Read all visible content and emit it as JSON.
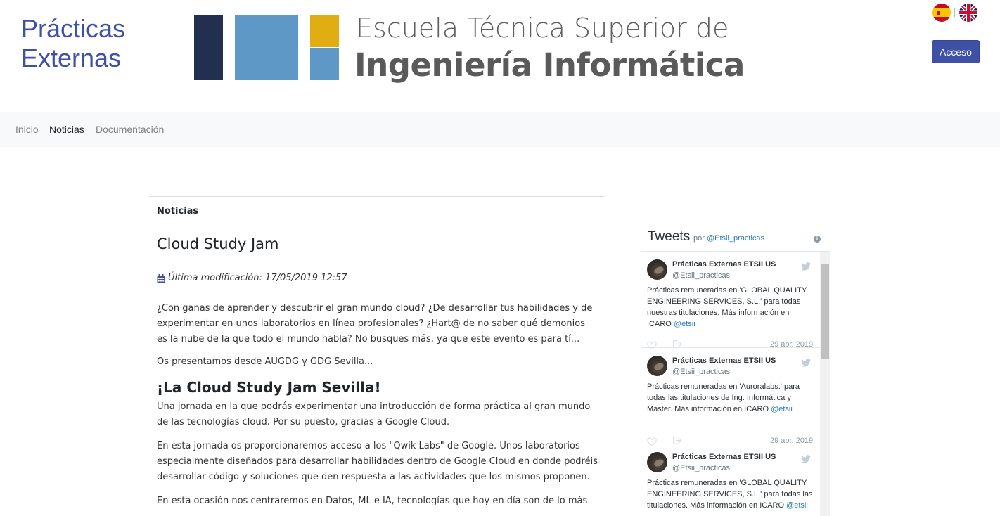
{
  "header": {
    "site_title_line1": "Prácticas",
    "site_title_line2": "Externas",
    "logo_line1": "Escuela Técnica Superior de",
    "logo_line2": "Ingeniería Informática",
    "lang_separator": "|",
    "login_button": "Acceso",
    "colors": {
      "brand": "#3f51a6",
      "logo_dark": "#232f4f",
      "logo_blue": "#5e98c6",
      "logo_yellow": "#e0ae12"
    }
  },
  "nav": {
    "items": [
      {
        "label": "Inicio",
        "active": false
      },
      {
        "label": "Noticias",
        "active": true
      },
      {
        "label": "Documentación",
        "active": false
      }
    ]
  },
  "main": {
    "section_title": "Noticias",
    "article": {
      "title": "Cloud Study Jam",
      "modified": "Última modificación: 17/05/2019 12:57",
      "paragraph1": "¿Con ganas de aprender y descubrir el gran mundo cloud? ¿De desarrollar tus habilidades y de experimentar en unos laboratorios en línea profesionales? ¿Hart@ de no saber qué demonios es la nube de la que todo el mundo habla? No busques más, ya que este evento es para tí...",
      "paragraph2": "Os presentamos desde AUGDG y GDG Sevilla...",
      "heading": "¡La Cloud Study Jam Sevilla!",
      "paragraph3": "Una jornada en la que podrás experimentar una introducción de forma práctica al gran mundo de las tecnologías cloud. Por su puesto, gracias a Google Cloud.",
      "paragraph4": "En esta jornada os proporcionaremos acceso a los \"Qwik Labs\" de Google. Unos laboratorios especialmente diseñados para desarrollar habilidades dentro de Google Cloud en donde podréis desarrollar código y soluciones que den respuesta a las actividades que los mismos proponen.",
      "paragraph5": "En esta ocasión nos centraremos en Datos, ML e IA, tecnologías que hoy en día son de lo más"
    }
  },
  "tweets": {
    "title": "Tweets",
    "by_prefix": "por",
    "by_handle": "@Etsii_practicas",
    "info_glyph": "i",
    "items": [
      {
        "name": "Prácticas Externas ETSII US",
        "handle": "@Etsii_practicas",
        "text": "Prácticas remuneradas en 'GLOBAL QUALITY ENGINEERING SERVICES, S.L.' para todas nuestras titulaciones. Más información en ICARO",
        "mention": "@etsii",
        "date": "29 abr. 2019"
      },
      {
        "name": "Prácticas Externas ETSII US",
        "handle": "@Etsii_practicas",
        "text": "Prácticas remuneradas en 'Auroralabs.' para todas las titulaciones de Ing. Informática y Máster. Más información en ICARO",
        "mention": "@etsii",
        "date": "29 abr. 2019"
      },
      {
        "name": "Prácticas Externas ETSII US",
        "handle": "@Etsii_practicas",
        "text": "Prácticas remuneradas en 'GLOBAL QUALITY ENGINEERING SERVICES, S.L.' para todas las titulaciones. Más información en ICARO",
        "mention": "@etsii",
        "date": ""
      }
    ]
  },
  "icons": [
    "spain-flag-icon",
    "uk-flag-icon",
    "calendar-icon",
    "info-icon",
    "twitter-bird-icon",
    "heart-icon",
    "share-icon"
  ]
}
